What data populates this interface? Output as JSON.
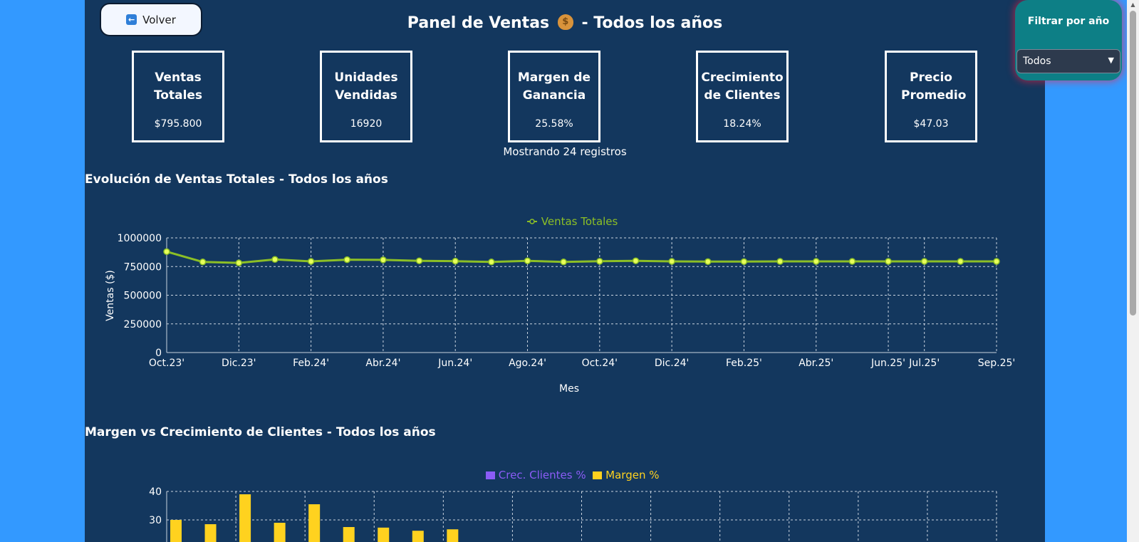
{
  "back_button": {
    "label": "Volver",
    "icon": "arrow-left-icon"
  },
  "header": {
    "title_prefix": "Panel de Ventas",
    "title_suffix": "- Todos los años",
    "icon": "money-bag-icon"
  },
  "kpis": [
    {
      "title": "Ventas Totales",
      "value": "$795.800"
    },
    {
      "title": "Unidades Vendidas",
      "value": "16920"
    },
    {
      "title": "Margen de Ganancia",
      "value": "25.58%"
    },
    {
      "title": "Crecimiento de Clientes",
      "value": "18.24%"
    },
    {
      "title": "Precio Promedio",
      "value": "$47.03"
    }
  ],
  "records_text": "Mostrando 24 registros",
  "filter": {
    "label": "Filtrar por año",
    "selected": "Todos"
  },
  "colors": {
    "panel": "#13375e",
    "page": "#3399ff",
    "line": "#8cbf26",
    "point": "#e8ff5a",
    "margin_bar": "#ffd21f",
    "growth_bar": "#8b5cf6",
    "filter": "#0d7f86"
  },
  "sales_chart": {
    "title": "Evolución de Ventas Totales - Todos los años",
    "chart_data": {
      "type": "line",
      "series_name": "Ventas Totales",
      "xlabel": "Mes",
      "ylabel": "Ventas ($)",
      "ylim": [
        0,
        1000000
      ],
      "yticks": [
        "0",
        "250000",
        "500000",
        "750000",
        "1000000"
      ],
      "x": [
        "Oct.23'",
        "Nov.23'",
        "Dic.23'",
        "Ene.24'",
        "Feb.24'",
        "Mar.24'",
        "Abr.24'",
        "May.24'",
        "Jun.24'",
        "Jul.24'",
        "Ago.24'",
        "Sep.24'",
        "Oct.24'",
        "Nov.24'",
        "Dic.24'",
        "Ene.25'",
        "Feb.25'",
        "Mar.25'",
        "Abr.25'",
        "May.25'",
        "Jun.25'",
        "Jul.25'",
        "Ago.25'",
        "Sep.25'"
      ],
      "x_tick_labels": [
        "Oct.23'",
        "Dic.23'",
        "Feb.24'",
        "Abr.24'",
        "Jun.24'",
        "Ago.24'",
        "Oct.24'",
        "Dic.24'",
        "Feb.25'",
        "Abr.25'",
        "Jun.25'",
        "Jul.25'",
        "Sep.25'"
      ],
      "values": [
        880000,
        790000,
        782000,
        812000,
        795000,
        810000,
        808000,
        800000,
        797000,
        790000,
        800000,
        790000,
        796000,
        800000,
        795000,
        793000,
        793000,
        795000,
        795000,
        795000,
        795000,
        795000,
        795000,
        795000
      ],
      "grid": true,
      "legend": "top-center"
    }
  },
  "margin_chart": {
    "title": "Margen vs Crecimiento de Clientes - Todos los años",
    "chart_data": {
      "type": "bar",
      "ylim": [
        0,
        40
      ],
      "yticks": [
        "30",
        "40"
      ],
      "series": [
        {
          "name": "Crec. Clientes %",
          "values": []
        },
        {
          "name": "Margen %",
          "values": [
            30,
            28.5,
            39,
            29,
            35.5,
            27.5,
            27.3,
            26.2,
            26.7
          ]
        }
      ],
      "grid": true,
      "legend": "top-center"
    }
  }
}
